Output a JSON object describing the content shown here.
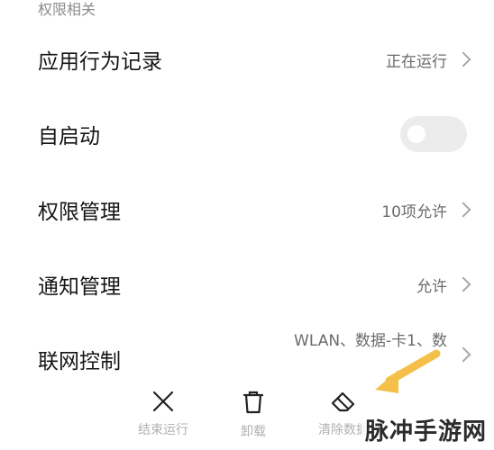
{
  "section_label": "权限相关",
  "rows": [
    {
      "title": "应用行为记录",
      "value": "正在运行"
    },
    {
      "title": "自启动",
      "toggle": false
    },
    {
      "title": "权限管理",
      "value": "10项允许"
    },
    {
      "title": "通知管理",
      "value": "允许"
    },
    {
      "title": "联网控制",
      "value": "WLAN、数据-卡1、数"
    }
  ],
  "actions": [
    {
      "label": "结束运行",
      "icon": "close-icon"
    },
    {
      "label": "卸载",
      "icon": "trash-icon"
    },
    {
      "label": "清除数据",
      "icon": "eraser-icon"
    }
  ],
  "watermark": "脉冲手游网",
  "colors": {
    "highlight_arrow": "#f4c04a",
    "muted_text": "#b0b0b0"
  }
}
